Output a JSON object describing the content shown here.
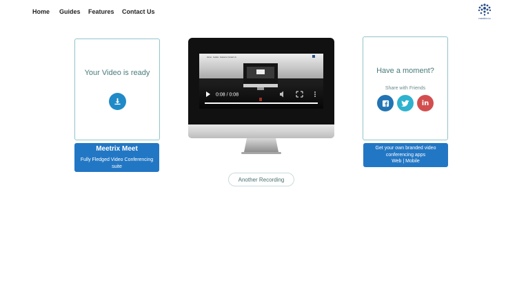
{
  "nav": {
    "items": [
      {
        "label": "Home"
      },
      {
        "label": "Guides"
      },
      {
        "label": "Features"
      },
      {
        "label": "Contact Us"
      }
    ],
    "logo_text": "meetrix.io"
  },
  "left_card": {
    "title": "Your Video is ready",
    "download_icon": "download-icon"
  },
  "promo_left": {
    "title": "Meetrix Meet",
    "subtitle": "Fully Fledged Video Conferencing suite"
  },
  "video": {
    "time": "0:08 / 0:08",
    "progress": 1.0,
    "mini_nav": [
      "Home",
      "Guides",
      "Features",
      "Contact Us"
    ]
  },
  "right_card": {
    "title": "Have a moment?",
    "share_label": "Share with Friends",
    "socials": [
      {
        "icon": "facebook-icon",
        "color": "#2274b3"
      },
      {
        "icon": "twitter-icon",
        "color": "#2eb2cf"
      },
      {
        "icon": "linkedin-icon",
        "color": "#d24e4e"
      }
    ]
  },
  "promo_right": {
    "line1": "Get your own branded video conferencing apps",
    "line2": "Web | Mobile"
  },
  "another_button": {
    "label": "Another Recording"
  },
  "colors": {
    "accent_blue": "#2277c4",
    "card_border": "#8fc4c8",
    "title_teal": "#4a7a7a"
  }
}
